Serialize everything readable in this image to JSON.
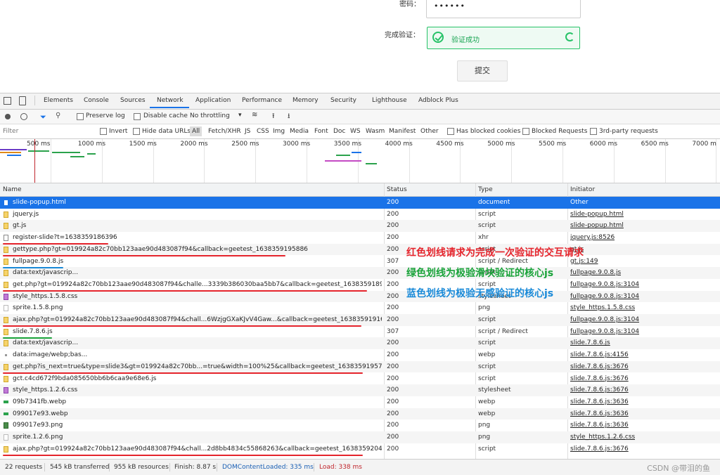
{
  "login": {
    "password_label": "密码：",
    "password_value": "••••••",
    "verify_label": "完成验证：",
    "verify_text": "验证成功",
    "submit_label": "提交"
  },
  "devtools": {
    "tabs": [
      "Elements",
      "Console",
      "Sources",
      "Network",
      "Application",
      "Performance",
      "Memory",
      "Security",
      "Lighthouse",
      "Adblock Plus"
    ],
    "active_tab": "Network",
    "toolbar": {
      "preserve_log": "Preserve log",
      "disable_cache": "Disable cache",
      "throttling": "No throttling"
    },
    "filter_bar": {
      "filter_placeholder": "Filter",
      "invert": "Invert",
      "hide_data_urls": "Hide data URLs",
      "types": [
        "All",
        "Fetch/XHR",
        "JS",
        "CSS",
        "Img",
        "Media",
        "Font",
        "Doc",
        "WS",
        "Wasm",
        "Manifest",
        "Other"
      ],
      "has_blocked_cookies": "Has blocked cookies",
      "blocked_requests": "Blocked Requests",
      "third_party": "3rd-party requests"
    },
    "timeline_ticks": [
      "500 ms",
      "1000 ms",
      "1500 ms",
      "2000 ms",
      "2500 ms",
      "3000 ms",
      "3500 ms",
      "4000 ms",
      "4500 ms",
      "5000 ms",
      "5500 ms",
      "6000 ms",
      "6500 ms",
      "7000 m"
    ],
    "columns": {
      "name": "Name",
      "status": "Status",
      "type": "Type",
      "initiator": "Initiator"
    },
    "rows": [
      {
        "name": "slide-popup.html",
        "status": "200",
        "type": "document",
        "initiator": "Other",
        "icon": "doc"
      },
      {
        "name": "jquery.js",
        "status": "200",
        "type": "script",
        "initiator": "slide-popup.html",
        "icon": "js"
      },
      {
        "name": "gt.js",
        "status": "200",
        "type": "script",
        "initiator": "slide-popup.html",
        "icon": "js"
      },
      {
        "name": "register-slide?t=1638359186396",
        "status": "200",
        "type": "xhr",
        "initiator": "jquery.js:8526",
        "icon": "xhr"
      },
      {
        "name": "gettype.php?gt=019924a82c70bb123aae90d483087f94&callback=geetest_1638359195886",
        "status": "200",
        "type": "script",
        "initiator": "gt.js",
        "icon": "js"
      },
      {
        "name": "fullpage.9.0.8.js",
        "status": "307",
        "type": "script / Redirect",
        "initiator": "gt.js:149",
        "icon": "js"
      },
      {
        "name": "data:text/javascrip...",
        "status": "200",
        "type": "script",
        "initiator": "fullpage.9.0.8.js",
        "icon": "js"
      },
      {
        "name": "get.php?gt=019924a82c70bb123aae90d483087f94&challe...3339b386030baa5bb7&callback=geetest_1638359189433",
        "status": "200",
        "type": "script",
        "initiator": "fullpage.9.0.8.js:3104",
        "icon": "js"
      },
      {
        "name": "style_https.1.5.8.css",
        "status": "200",
        "type": "stylesheet",
        "initiator": "fullpage.9.0.8.js:3104",
        "icon": "css"
      },
      {
        "name": "sprite.1.5.8.png",
        "status": "200",
        "type": "png",
        "initiator": "style_https.1.5.8.css",
        "icon": "img"
      },
      {
        "name": "ajax.php?gt=019924a82c70bb123aae90d483087f94&chall...6WzjgGXaKJvV4Gaw...&callback=geetest_1638359191660",
        "status": "200",
        "type": "script",
        "initiator": "fullpage.9.0.8.js:3104",
        "icon": "js"
      },
      {
        "name": "slide.7.8.6.js",
        "status": "307",
        "type": "script / Redirect",
        "initiator": "fullpage.9.0.8.js:3104",
        "icon": "js"
      },
      {
        "name": "data:text/javascrip...",
        "status": "200",
        "type": "script",
        "initiator": "slide.7.8.6.js",
        "icon": "js"
      },
      {
        "name": "data:image/webp;bas...",
        "status": "200",
        "type": "webp",
        "initiator": "slide.7.8.6.js:4156",
        "icon": "dot"
      },
      {
        "name": "get.php?is_next=true&type=slide3&gt=019924a82c70bb...=true&width=100%25&callback=geetest_1638359195770",
        "status": "200",
        "type": "script",
        "initiator": "slide.7.8.6.js:3676",
        "icon": "js"
      },
      {
        "name": "gct.c4cd672f9bda085650bb6b6caa9e68e6.js",
        "status": "200",
        "type": "script",
        "initiator": "slide.7.8.6.js:3676",
        "icon": "js"
      },
      {
        "name": "style_https.1.2.6.css",
        "status": "200",
        "type": "stylesheet",
        "initiator": "slide.7.8.6.js:3676",
        "icon": "css"
      },
      {
        "name": "09b7341fb.webp",
        "status": "200",
        "type": "webp",
        "initiator": "slide.7.8.6.js:3636",
        "icon": "webp"
      },
      {
        "name": "099017e93.webp",
        "status": "200",
        "type": "webp",
        "initiator": "slide.7.8.6.js:3636",
        "icon": "webp"
      },
      {
        "name": "099017e93.png",
        "status": "200",
        "type": "png",
        "initiator": "slide.7.8.6.js:3636",
        "icon": "png"
      },
      {
        "name": "sprite.1.2.6.png",
        "status": "200",
        "type": "png",
        "initiator": "style_https.1.2.6.css",
        "icon": "img"
      },
      {
        "name": "ajax.php?gt=019924a82c70bb123aae90d483087f94&chall...2d8bb4834c55868263&callback=geetest_1638359204428",
        "status": "200",
        "type": "script",
        "initiator": "slide.7.8.6.js:3676",
        "icon": "js"
      }
    ],
    "annotations": {
      "red": "红色划线请求为完成一次验证的交互请求",
      "green": "绿色划线为极验滑块验证的核心js",
      "blue": "蓝色划线为极验无感验证的核心js"
    },
    "status_bar": {
      "requests": "22 requests",
      "transferred": "545 kB transferred",
      "resources": "955 kB resources",
      "finish": "Finish: 8.87 s",
      "dom_loaded": "DOMContentLoaded: 335 ms",
      "load": "Load: 338 ms"
    },
    "watermark": "CSDN @带泪的鱼"
  },
  "colors": {
    "red": "#e5242c",
    "green": "#1aa33a",
    "blue": "#1a8ad8",
    "accent": "#1a73e8"
  }
}
